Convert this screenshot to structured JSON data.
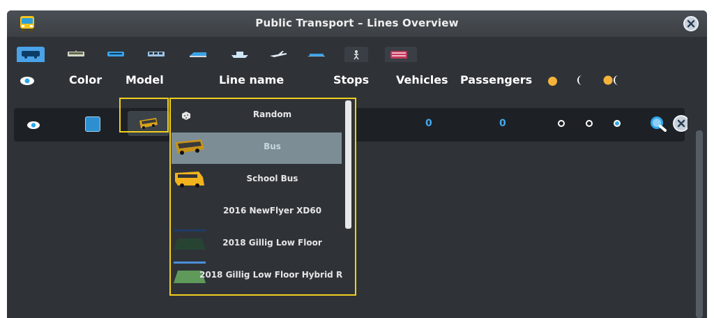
{
  "window": {
    "title": "Public Transport – Lines Overview",
    "title_icon": "bus-icon",
    "close_icon": "close-icon"
  },
  "tabs": [
    {
      "icon": "bus-icon",
      "active": true
    },
    {
      "icon": "tram-icon",
      "active": false
    },
    {
      "icon": "metro-icon",
      "active": false
    },
    {
      "icon": "train-icon",
      "active": false
    },
    {
      "icon": "monorail-icon",
      "active": false
    },
    {
      "icon": "ship-icon",
      "active": false
    },
    {
      "icon": "airplane-icon",
      "active": false
    },
    {
      "icon": "ferry-icon",
      "active": false
    },
    {
      "icon": "pedestrian-icon",
      "active": false
    },
    {
      "icon": "double-decker-icon",
      "active": false
    }
  ],
  "columns": {
    "visibility_icon": "eye-icon",
    "color": "Color",
    "model": "Model",
    "line_name": "Line name",
    "stops": "Stops",
    "vehicles": "Vehicles",
    "passengers": "Passengers",
    "day_icon": "sun-icon",
    "night_icon": "moon-icon",
    "daynight_icon": "sun-moon-icon"
  },
  "line_row": {
    "color": "#2e8fd0",
    "vehicles": "0",
    "passengers": "0",
    "schedule": {
      "day": false,
      "night": false,
      "day_night": true
    },
    "zoom_icon": "magnifier-icon",
    "delete_icon": "close-icon"
  },
  "model_dropdown": {
    "items": [
      {
        "label": "Random",
        "icon": "dice-icon",
        "selected": false
      },
      {
        "label": "Bus",
        "icon": "bus-thumbnail",
        "selected": true
      },
      {
        "label": "School Bus",
        "icon": "school-bus-thumbnail",
        "selected": false
      },
      {
        "label": "2016 NewFlyer XD60",
        "icon": "blank-thumbnail",
        "selected": false
      },
      {
        "label": "2018 Gillig Low Floor",
        "icon": "gillig-thumbnail",
        "selected": false
      },
      {
        "label": "2018 Gillig Low Floor Hybrid R",
        "icon": "gillig-hybrid-thumbnail",
        "selected": false
      }
    ]
  },
  "colors": {
    "accent": "#43a9f0",
    "highlight": "#f2cf1e",
    "panel": "#2f3338",
    "row": "#1d2125"
  }
}
